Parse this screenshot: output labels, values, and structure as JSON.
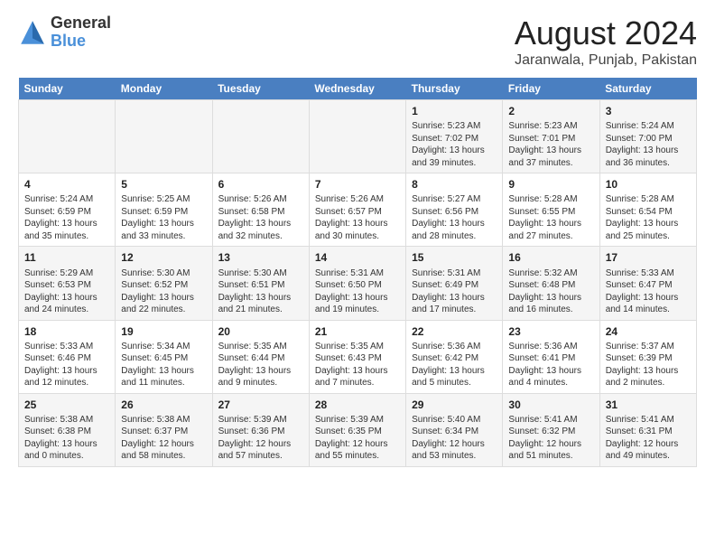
{
  "header": {
    "logo_line1": "General",
    "logo_line2": "Blue",
    "title": "August 2024",
    "subtitle": "Jaranwala, Punjab, Pakistan"
  },
  "days_of_week": [
    "Sunday",
    "Monday",
    "Tuesday",
    "Wednesday",
    "Thursday",
    "Friday",
    "Saturday"
  ],
  "weeks": [
    [
      {
        "day": "",
        "info": ""
      },
      {
        "day": "",
        "info": ""
      },
      {
        "day": "",
        "info": ""
      },
      {
        "day": "",
        "info": ""
      },
      {
        "day": "1",
        "info": "Sunrise: 5:23 AM\nSunset: 7:02 PM\nDaylight: 13 hours\nand 39 minutes."
      },
      {
        "day": "2",
        "info": "Sunrise: 5:23 AM\nSunset: 7:01 PM\nDaylight: 13 hours\nand 37 minutes."
      },
      {
        "day": "3",
        "info": "Sunrise: 5:24 AM\nSunset: 7:00 PM\nDaylight: 13 hours\nand 36 minutes."
      }
    ],
    [
      {
        "day": "4",
        "info": "Sunrise: 5:24 AM\nSunset: 6:59 PM\nDaylight: 13 hours\nand 35 minutes."
      },
      {
        "day": "5",
        "info": "Sunrise: 5:25 AM\nSunset: 6:59 PM\nDaylight: 13 hours\nand 33 minutes."
      },
      {
        "day": "6",
        "info": "Sunrise: 5:26 AM\nSunset: 6:58 PM\nDaylight: 13 hours\nand 32 minutes."
      },
      {
        "day": "7",
        "info": "Sunrise: 5:26 AM\nSunset: 6:57 PM\nDaylight: 13 hours\nand 30 minutes."
      },
      {
        "day": "8",
        "info": "Sunrise: 5:27 AM\nSunset: 6:56 PM\nDaylight: 13 hours\nand 28 minutes."
      },
      {
        "day": "9",
        "info": "Sunrise: 5:28 AM\nSunset: 6:55 PM\nDaylight: 13 hours\nand 27 minutes."
      },
      {
        "day": "10",
        "info": "Sunrise: 5:28 AM\nSunset: 6:54 PM\nDaylight: 13 hours\nand 25 minutes."
      }
    ],
    [
      {
        "day": "11",
        "info": "Sunrise: 5:29 AM\nSunset: 6:53 PM\nDaylight: 13 hours\nand 24 minutes."
      },
      {
        "day": "12",
        "info": "Sunrise: 5:30 AM\nSunset: 6:52 PM\nDaylight: 13 hours\nand 22 minutes."
      },
      {
        "day": "13",
        "info": "Sunrise: 5:30 AM\nSunset: 6:51 PM\nDaylight: 13 hours\nand 21 minutes."
      },
      {
        "day": "14",
        "info": "Sunrise: 5:31 AM\nSunset: 6:50 PM\nDaylight: 13 hours\nand 19 minutes."
      },
      {
        "day": "15",
        "info": "Sunrise: 5:31 AM\nSunset: 6:49 PM\nDaylight: 13 hours\nand 17 minutes."
      },
      {
        "day": "16",
        "info": "Sunrise: 5:32 AM\nSunset: 6:48 PM\nDaylight: 13 hours\nand 16 minutes."
      },
      {
        "day": "17",
        "info": "Sunrise: 5:33 AM\nSunset: 6:47 PM\nDaylight: 13 hours\nand 14 minutes."
      }
    ],
    [
      {
        "day": "18",
        "info": "Sunrise: 5:33 AM\nSunset: 6:46 PM\nDaylight: 13 hours\nand 12 minutes."
      },
      {
        "day": "19",
        "info": "Sunrise: 5:34 AM\nSunset: 6:45 PM\nDaylight: 13 hours\nand 11 minutes."
      },
      {
        "day": "20",
        "info": "Sunrise: 5:35 AM\nSunset: 6:44 PM\nDaylight: 13 hours\nand 9 minutes."
      },
      {
        "day": "21",
        "info": "Sunrise: 5:35 AM\nSunset: 6:43 PM\nDaylight: 13 hours\nand 7 minutes."
      },
      {
        "day": "22",
        "info": "Sunrise: 5:36 AM\nSunset: 6:42 PM\nDaylight: 13 hours\nand 5 minutes."
      },
      {
        "day": "23",
        "info": "Sunrise: 5:36 AM\nSunset: 6:41 PM\nDaylight: 13 hours\nand 4 minutes."
      },
      {
        "day": "24",
        "info": "Sunrise: 5:37 AM\nSunset: 6:39 PM\nDaylight: 13 hours\nand 2 minutes."
      }
    ],
    [
      {
        "day": "25",
        "info": "Sunrise: 5:38 AM\nSunset: 6:38 PM\nDaylight: 13 hours\nand 0 minutes."
      },
      {
        "day": "26",
        "info": "Sunrise: 5:38 AM\nSunset: 6:37 PM\nDaylight: 12 hours\nand 58 minutes."
      },
      {
        "day": "27",
        "info": "Sunrise: 5:39 AM\nSunset: 6:36 PM\nDaylight: 12 hours\nand 57 minutes."
      },
      {
        "day": "28",
        "info": "Sunrise: 5:39 AM\nSunset: 6:35 PM\nDaylight: 12 hours\nand 55 minutes."
      },
      {
        "day": "29",
        "info": "Sunrise: 5:40 AM\nSunset: 6:34 PM\nDaylight: 12 hours\nand 53 minutes."
      },
      {
        "day": "30",
        "info": "Sunrise: 5:41 AM\nSunset: 6:32 PM\nDaylight: 12 hours\nand 51 minutes."
      },
      {
        "day": "31",
        "info": "Sunrise: 5:41 AM\nSunset: 6:31 PM\nDaylight: 12 hours\nand 49 minutes."
      }
    ]
  ]
}
